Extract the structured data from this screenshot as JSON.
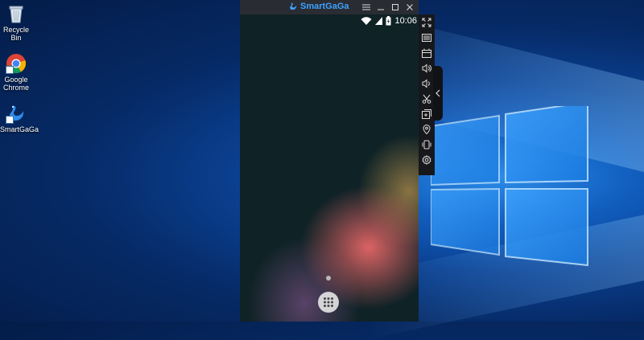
{
  "desktop": {
    "icons": [
      {
        "label": "Recycle Bin"
      },
      {
        "label": "Google Chrome"
      },
      {
        "label": "SmartGaGa"
      }
    ]
  },
  "emulator": {
    "title": "SmartGaGa",
    "title_buttons": [
      "menu-icon",
      "minimize-icon",
      "restore-icon",
      "close-icon"
    ],
    "status": {
      "time": "10:06"
    },
    "toolbar_tools": [
      "fullscreen-icon",
      "keyboard-icon",
      "screen-record-icon",
      "volume-up-icon",
      "volume-down-icon",
      "scissors-icon",
      "add-app-icon",
      "location-icon",
      "shake-icon",
      "settings-icon"
    ]
  },
  "colors": {
    "accent": "#3da2ff",
    "titlebar": "#2a2c33",
    "desktop_bg": "#0a3f8f"
  }
}
